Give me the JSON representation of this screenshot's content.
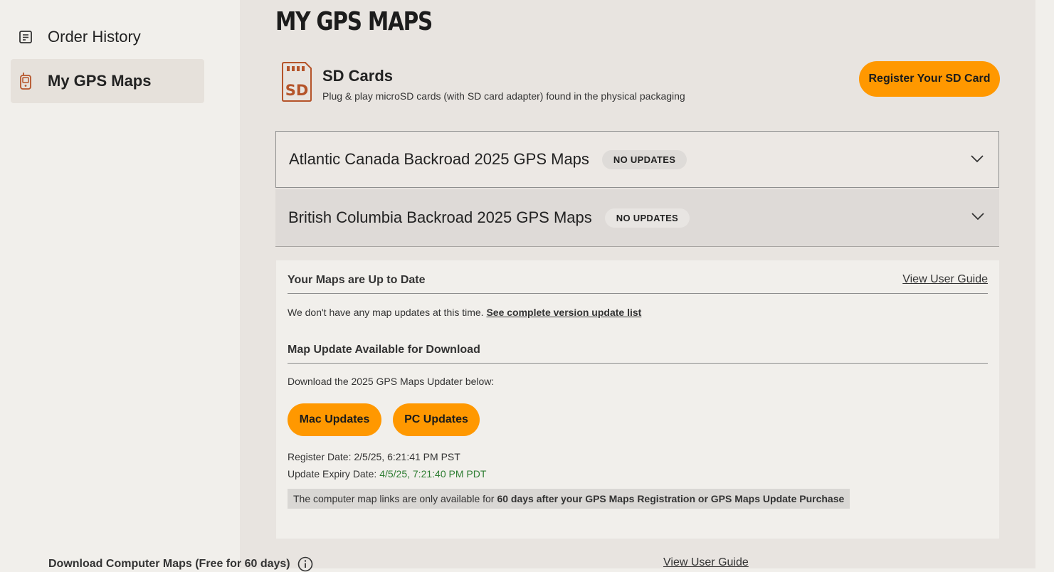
{
  "sidebar": {
    "items": [
      {
        "label": "Order History",
        "icon": "receipt-icon",
        "active": false
      },
      {
        "label": "My GPS Maps",
        "icon": "gps-device-icon",
        "active": true
      }
    ]
  },
  "page": {
    "title": "MY GPS MAPS"
  },
  "sd_cards": {
    "icon_text": "SD",
    "title": "SD Cards",
    "subtitle": "Plug & play microSD cards (with SD card adapter) found in the physical packaging",
    "register_label": "Register Your SD Card"
  },
  "maps": [
    {
      "title": "Atlantic Canada Backroad 2025 GPS Maps",
      "badge": "NO UPDATES",
      "expanded": false
    },
    {
      "title": "British Columbia Backroad 2025 GPS Maps",
      "badge": "NO UPDATES",
      "expanded": true
    }
  ],
  "panel": {
    "status_title": "Your Maps are Up to Date",
    "user_guide_label": "View User Guide",
    "no_updates_text": "We don't have any map updates at this time.",
    "version_list_link": "See complete version update list",
    "download_title": "Map Update Available for Download",
    "download_text": "Download the 2025 GPS Maps Updater below:",
    "mac_label": "Mac Updates",
    "pc_label": "PC Updates",
    "register_date_label": "Register Date:",
    "register_date_value": "2/5/25, 6:21:41 PM PST",
    "expiry_label": "Update Expiry Date:",
    "expiry_value": "4/5/25, 7:21:40 PM PDT",
    "note_text": "The computer map links are only available for",
    "note_bold": "60 days after your GPS Maps Registration or GPS Maps Update Purchase"
  },
  "computer_maps": {
    "title": "Download Computer Maps (Free for 60 days)",
    "user_guide_label": "View User Guide"
  },
  "colors": {
    "accent": "#ff9800",
    "expiry": "#2e7d32",
    "sd_icon": "#b5542a"
  }
}
